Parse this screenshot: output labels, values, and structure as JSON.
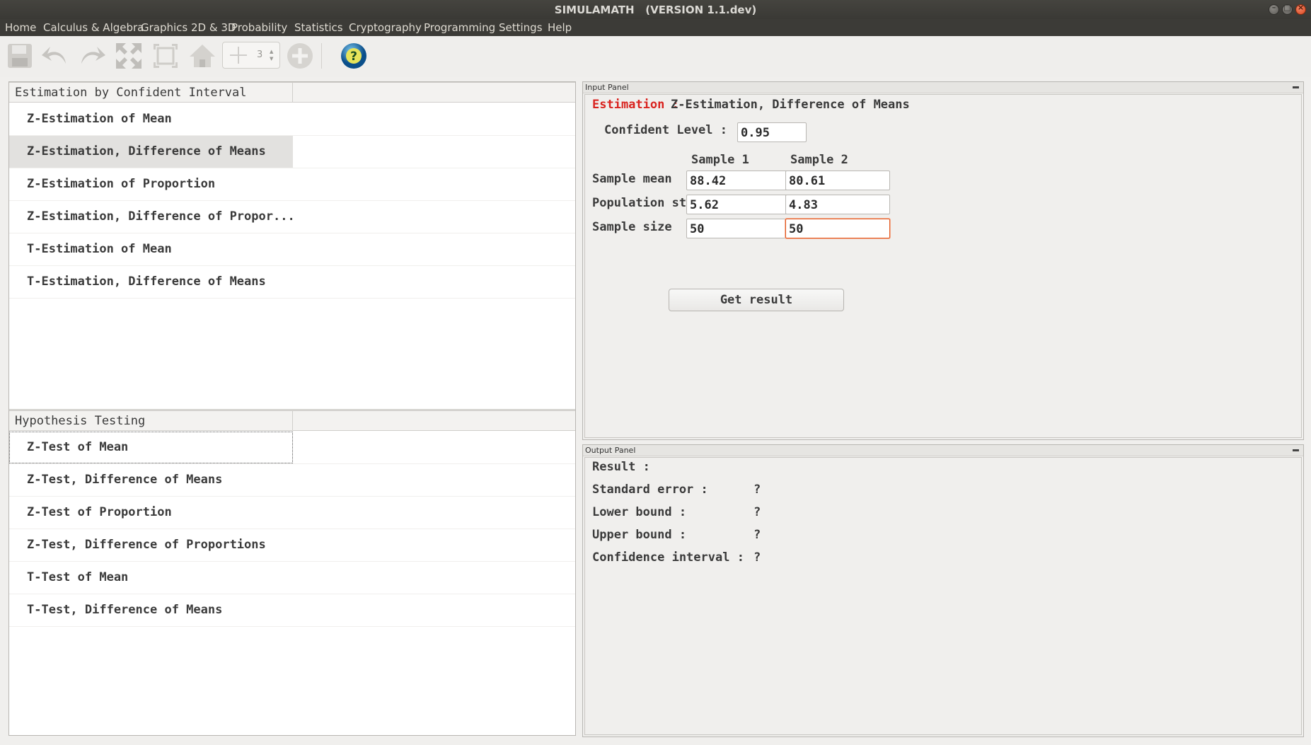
{
  "window": {
    "title": "SIMULAMATH   (VERSION 1.1.dev)"
  },
  "menu": [
    "Home",
    "Calculus & Algebra",
    "Graphics 2D & 3D",
    "Probability",
    "Statistics",
    "Cryptography",
    "Programming",
    "Settings",
    "Help"
  ],
  "toolbar": {
    "icons": [
      "save-icon",
      "undo-icon",
      "redo-icon",
      "expand-icon",
      "fit-icon",
      "home-icon",
      "zoom-spinner",
      "add-icon",
      "help-icon"
    ],
    "spinner_value": "3"
  },
  "left": {
    "estimation": {
      "header": "Estimation by Confident Interval",
      "items": [
        "Z-Estimation of Mean",
        "Z-Estimation, Difference of Means",
        "Z-Estimation of Proportion",
        "Z-Estimation, Difference of Propor...",
        "T-Estimation of Mean",
        "T-Estimation, Difference of Means"
      ],
      "selected_index": 1
    },
    "testing": {
      "header": "Hypothesis Testing",
      "items": [
        "Z-Test of Mean",
        "Z-Test, Difference of Means",
        "Z-Test of Proportion",
        "Z-Test, Difference of Proportions",
        "T-Test of Mean",
        "T-Test, Difference of Means"
      ],
      "focused_index": 0
    }
  },
  "input_panel": {
    "header": "Input Panel",
    "title_prefix": "Estimation :",
    "title": "Z-Estimation, Difference of Means",
    "confident_label": "Confident Level :",
    "confident_value": "0.95",
    "col1": "Sample 1",
    "col2": "Sample 2",
    "rows": [
      {
        "label": "Sample mean",
        "v1": "88.42",
        "v2": "80.61"
      },
      {
        "label": "Population std",
        "v1": "5.62",
        "v2": "4.83"
      },
      {
        "label": "Sample size",
        "v1": "50",
        "v2": "50"
      }
    ],
    "button": "Get result"
  },
  "output_panel": {
    "header": "Output Panel",
    "result_label": "Result :",
    "lines": [
      {
        "label": "Standard error :",
        "value": "?"
      },
      {
        "label": "Lower bound :",
        "value": "?"
      },
      {
        "label": "Upper bound :",
        "value": "?"
      },
      {
        "label": "Confidence interval :",
        "value": "?"
      }
    ]
  }
}
